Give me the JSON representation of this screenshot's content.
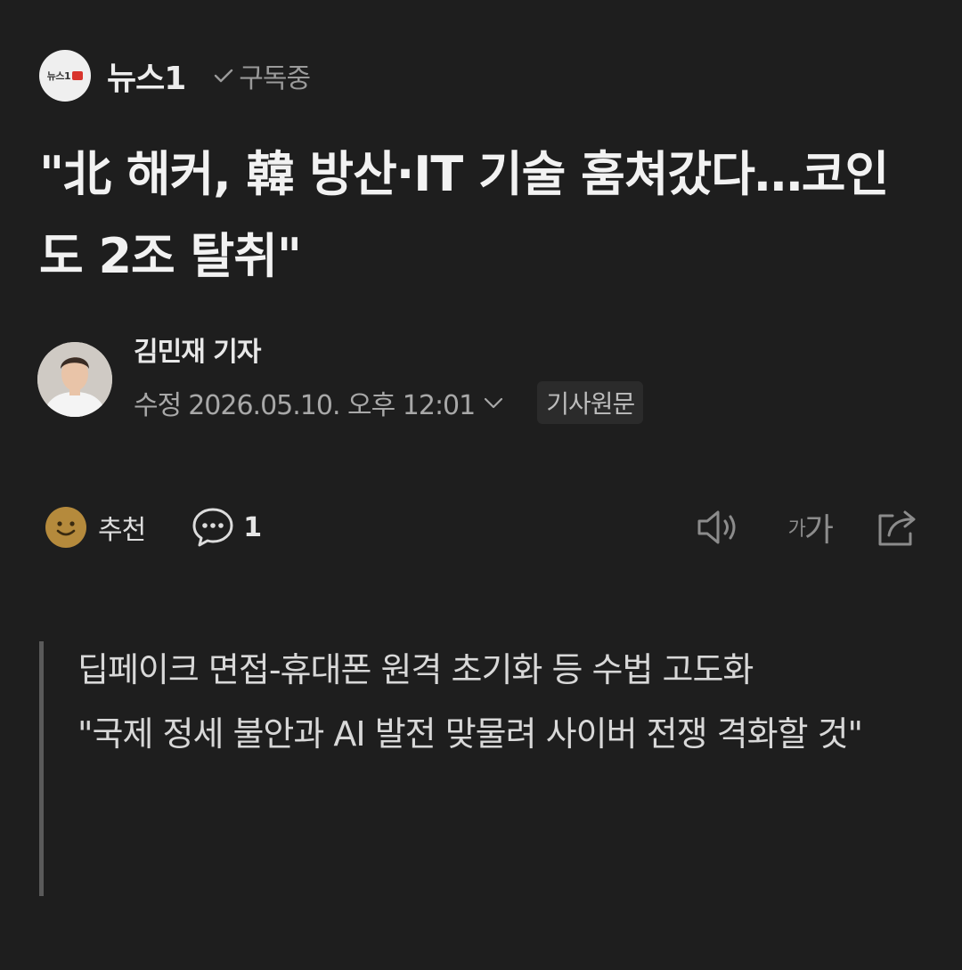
{
  "publisher": {
    "logo_text": "뉴스1",
    "name": "뉴스1",
    "subscribe_label": "구독중"
  },
  "article": {
    "title": "\"北 해커, 韓 방산·IT 기술 훔쳐갔다…코인도 2조 탈취\"",
    "reporter": "김민재 기자",
    "modified_label": "수정",
    "timestamp": "2026.05.10. 오후 12:01",
    "original_link": "기사원문",
    "summary": [
      "딥페이크 면접-휴대폰 원격 초기화 등 수법 고도화",
      "\"국제 정세 불안과 AI 발전 맞물려 사이버 전쟁 격화할 것\""
    ]
  },
  "actions": {
    "recommend_label": "추천",
    "comment_count": "1",
    "font_small": "가",
    "font_large": "가"
  },
  "icons": {
    "subscribe": "check-icon",
    "recommend": "smile-icon",
    "comment": "comment-bubble-icon",
    "audio": "speaker-icon",
    "share": "share-icon",
    "timestamp_toggle": "chevron-down-icon"
  },
  "colors": {
    "background": "#1e1e1e",
    "text_primary": "#f2f2f2",
    "text_secondary": "#a8a8a8",
    "recommend_icon": "#b58a3c",
    "logo_accent": "#d8342c"
  }
}
